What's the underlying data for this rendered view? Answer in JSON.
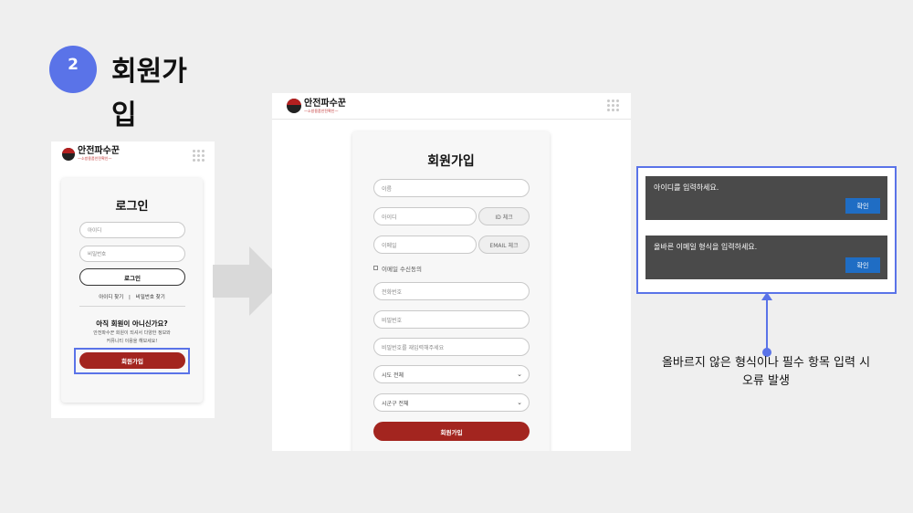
{
  "step": {
    "number": "2",
    "title": "회원가입"
  },
  "brand": {
    "name": "안전파수꾼",
    "tagline": "—소방용품안전확인—"
  },
  "login_screen": {
    "title": "로그인",
    "id_placeholder": "아이디",
    "pw_placeholder": "비밀번호",
    "login_button": "로그인",
    "find_id": "아이디 찾기",
    "separator": "|",
    "find_pw": "비밀번호 찾기",
    "not_member": "아직 회원이 아니신가요?",
    "desc_line1": "안전파수꾼 회원이 되셔서 다양한 정보와",
    "desc_line2": "커뮤니티 이용을 해보세요!",
    "signup_button": "회원가입"
  },
  "signup_screen": {
    "title": "회원가입",
    "name_placeholder": "이름",
    "id_placeholder": "아이디",
    "id_check": "ID 체크",
    "email_placeholder": "이메일",
    "email_check": "EMAIL 체크",
    "email_consent": "이메일 수신동의",
    "phone_placeholder": "전화번호",
    "pw_placeholder": "비밀번호",
    "pw_confirm_placeholder": "비밀번호를 재입력해주세요",
    "province_select": "시도 전체",
    "city_select": "시군구 전체",
    "submit_button": "회원가입"
  },
  "alerts": [
    {
      "message": "아이디를 입력하세요.",
      "button": "확인"
    },
    {
      "message": "올바른 이메일 형식을 입력하세요.",
      "button": "확인"
    }
  ],
  "annotation": {
    "line1": "올바르지 않은 형식이나 필수 항목 입력 시",
    "line2": "오류 발생"
  },
  "colors": {
    "accent": "#5a73e8",
    "brand_red": "#a3251f",
    "alert_bg": "#4a4a4a",
    "ok_blue": "#1f6dc4"
  }
}
